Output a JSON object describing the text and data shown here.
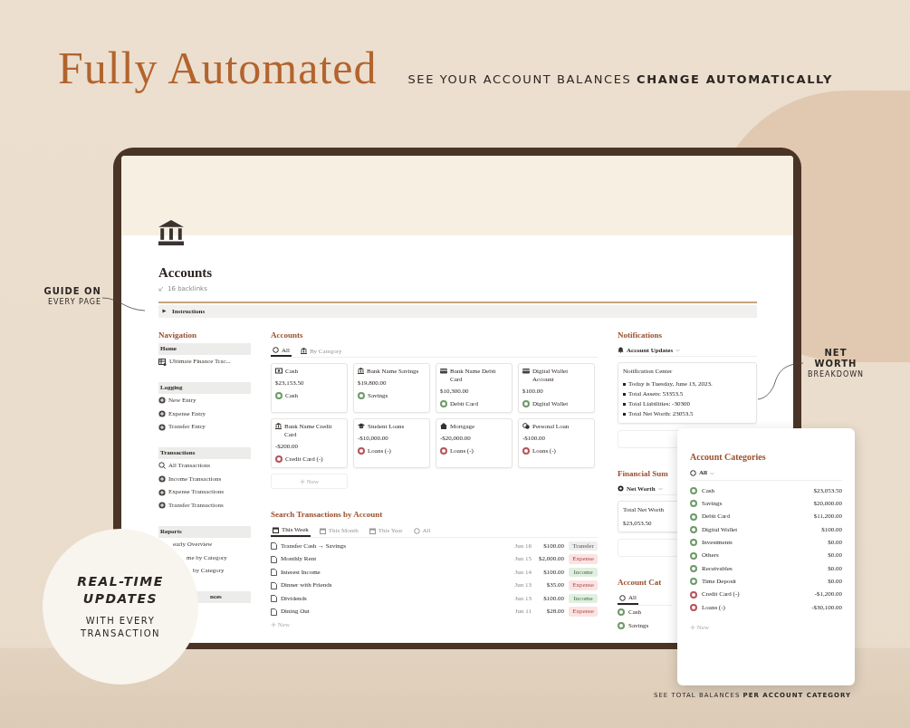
{
  "poster": {
    "title": "Fully Automated",
    "subtitle": "SEE YOUR ACCOUNT BALANCES **CHANGE AUTOMATICALLY**"
  },
  "callouts": [
    {
      "lines": [
        "GUIDE ON",
        "EVERY PAGE"
      ]
    },
    {
      "lines": [
        "NET",
        "WORTH",
        "BREAKDOWN"
      ]
    }
  ],
  "badge": {
    "title_lines": [
      "REAL-TIME",
      "UPDATES"
    ],
    "lines": [
      "WITH EVERY",
      "TRANSACTION"
    ]
  },
  "caption": "SEE TOTAL BALANCES **PER ACCOUNT CATEGORY**",
  "page": {
    "title": "Accounts",
    "backlinks": "16 backlinks",
    "toggle": "Instructions"
  },
  "sidebar": {
    "heading": "Navigation",
    "sections": [
      {
        "title": "Home",
        "items": [
          {
            "label": "Ultimate Finance Trac..."
          }
        ]
      },
      {
        "title": "Logging",
        "items": [
          {
            "label": "New Entry"
          },
          {
            "label": "Expense Entry"
          },
          {
            "label": "Transfer Entry"
          }
        ]
      },
      {
        "title": "Transactions",
        "items": [
          {
            "label": "All Transactions"
          },
          {
            "label": "Income Transactions"
          },
          {
            "label": "Expense Transactions"
          },
          {
            "label": "Transfer Transactions"
          }
        ]
      },
      {
        "title": "Reports",
        "items": [
          {
            "label": "early Overview"
          },
          {
            "label": "me by Category"
          },
          {
            "label": "by Category"
          }
        ]
      },
      {
        "title": "nces"
      }
    ]
  },
  "accounts": {
    "heading": "Accounts",
    "tabs": [
      {
        "label": "All",
        "selected": true
      },
      {
        "label": "By Category",
        "selected": false
      }
    ],
    "cards": [
      {
        "name": "Cash",
        "balance": "$23,153.50",
        "category": "Cash",
        "color": "#6f9a6a"
      },
      {
        "name": "Bank Name Savings",
        "balance": "$19,800.00",
        "category": "Savings",
        "color": "#6f9a6a"
      },
      {
        "name": "Bank Name Debit Card",
        "balance": "$10,300.00",
        "category": "Debit Card",
        "color": "#6f9a6a"
      },
      {
        "name": "Digital Wallet Account",
        "balance": "$100.00",
        "category": "Digital Wallet",
        "color": "#6f9a6a"
      },
      {
        "name": "Bank Name Credit Card",
        "balance": "-$200.00",
        "category": "Credit Card (-)",
        "color": "#b5555a"
      },
      {
        "name": "Student Loans",
        "balance": "-$10,000.00",
        "category": "Loans (-)",
        "color": "#b5555a"
      },
      {
        "name": "Mortgage",
        "balance": "-$20,000.00",
        "category": "Loans (-)",
        "color": "#b5555a"
      },
      {
        "name": "Personal Loan",
        "balance": "-$100.00",
        "category": "Loans (-)",
        "color": "#b5555a"
      }
    ],
    "new_label": "New"
  },
  "transactions": {
    "heading": "Search Transactions by Account",
    "tabs": [
      {
        "label": "This Week",
        "selected": true
      },
      {
        "label": "This Month",
        "selected": false
      },
      {
        "label": "This Year",
        "selected": false
      },
      {
        "label": "All",
        "selected": false
      }
    ],
    "rows": [
      {
        "name": "Transfer Cash → Savings",
        "date": "Jun 16",
        "amount": "$100.00",
        "type": "Transfer",
        "kind": "transfer"
      },
      {
        "name": "Monthly Rent",
        "date": "Jun 15",
        "amount": "$2,000.00",
        "type": "Expense",
        "kind": "expense"
      },
      {
        "name": "Interest Income",
        "date": "Jun 14",
        "amount": "$100.00",
        "type": "Income",
        "kind": "income"
      },
      {
        "name": "Dinner with Friends",
        "date": "Jun 13",
        "amount": "$35.00",
        "type": "Expense",
        "kind": "expense"
      },
      {
        "name": "Dividends",
        "date": "Jun 13",
        "amount": "$100.00",
        "type": "Income",
        "kind": "income"
      },
      {
        "name": "Dining Out",
        "date": "Jun 11",
        "amount": "$28.00",
        "type": "Expense",
        "kind": "expense"
      }
    ],
    "new_label": "New"
  },
  "notifications": {
    "heading": "Notifications",
    "view": "Account Updates",
    "card_title": "Notification Center",
    "bullets": [
      "Today is Tuesday, June 13, 2023.",
      "Total Assets: 53353.5",
      "Total Liabilities: -30300",
      "Total Net Worth: 23053.5"
    ]
  },
  "summary": {
    "heading": "Financial Sum",
    "view": "Net Worth",
    "card_title": "Total Net Worth",
    "card_value": "$23,053.50"
  },
  "categories_behind": {
    "heading": "Account Cat",
    "tabs": [
      {
        "label": "All",
        "selected": true
      }
    ],
    "items": [
      {
        "name": "Cash",
        "color": "#6f9a6a"
      },
      {
        "name": "Savings",
        "color": "#6f9a6a"
      }
    ]
  },
  "categories_card": {
    "heading": "Account Categories",
    "view": "All",
    "items": [
      {
        "name": "Cash",
        "total": "$23,053.50",
        "color": "#6f9a6a"
      },
      {
        "name": "Savings",
        "total": "$20,000.00",
        "color": "#6f9a6a"
      },
      {
        "name": "Debit Card",
        "total": "$11,200.00",
        "color": "#6f9a6a"
      },
      {
        "name": "Digital Wallet",
        "total": "$100.00",
        "color": "#6f9a6a"
      },
      {
        "name": "Investments",
        "total": "$0.00",
        "color": "#6f9a6a"
      },
      {
        "name": "Others",
        "total": "$0.00",
        "color": "#6f9a6a"
      },
      {
        "name": "Receivables",
        "total": "$0.00",
        "color": "#6f9a6a"
      },
      {
        "name": "Time Deposit",
        "total": "$0.00",
        "color": "#6f9a6a"
      },
      {
        "name": "Credit Card (-)",
        "total": "-$1,200.00",
        "color": "#b5555a"
      },
      {
        "name": "Loans (-)",
        "total": "-$30,100.00",
        "color": "#b5555a"
      }
    ],
    "new_label": "New"
  }
}
